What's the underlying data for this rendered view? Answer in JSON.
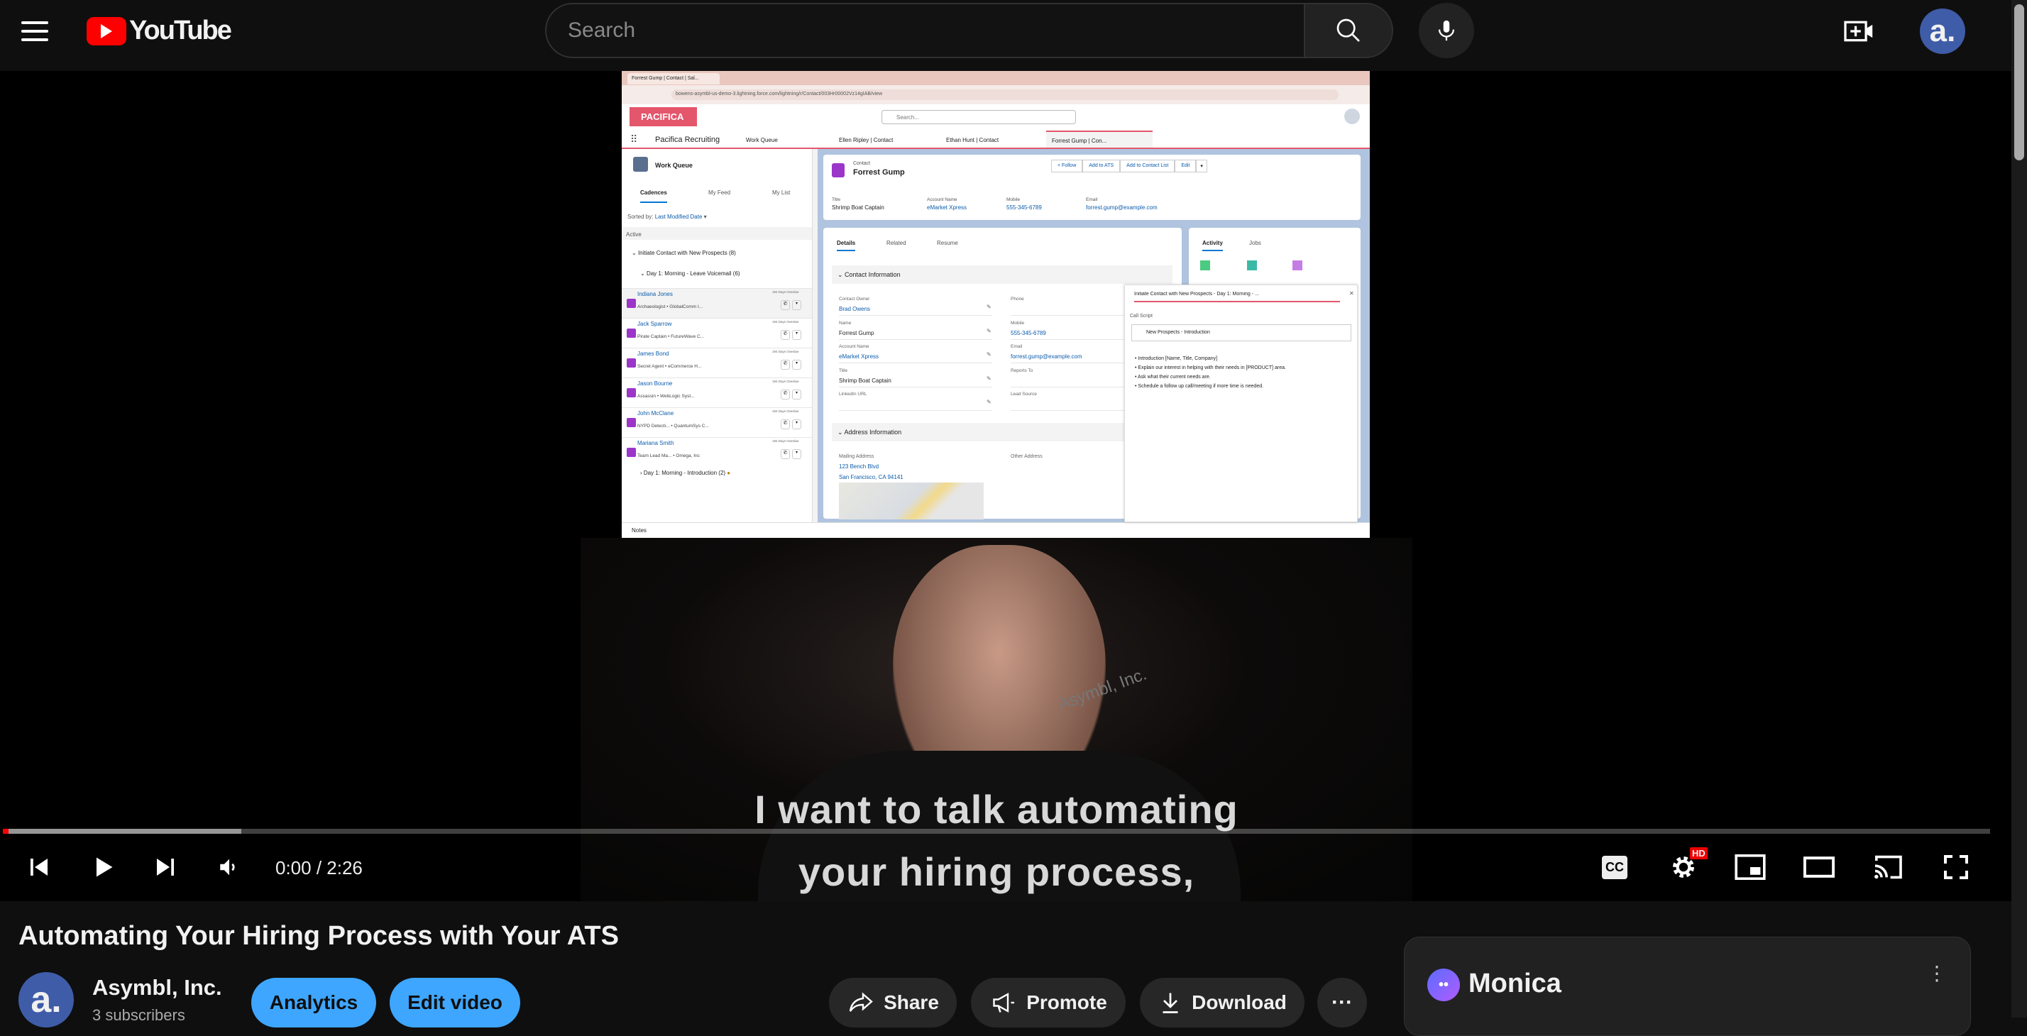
{
  "header": {
    "logo_text": "YouTube",
    "search_placeholder": "Search",
    "icons": [
      "menu-icon",
      "search-icon",
      "microphone-icon",
      "create-video-icon",
      "avatar"
    ],
    "brand_color": "#ff0000"
  },
  "video": {
    "embedded_screen": {
      "browser_tab": "Forrest Gump | Contact | Sal...",
      "url": "bowens-asymbl-us-demo-3.lightning.force.com/lightning/r/Contact/003Hr00002Vz14gIAB/view",
      "logo": "PACIFICA",
      "search_placeholder": "Search...",
      "app_name": "Pacifica Recruiting",
      "nav_tabs": [
        "Work Queue",
        "Ellen Ripley | Contact",
        "Ethan Hunt | Contact",
        "Forrest Gump | Con..."
      ],
      "work_queue": {
        "title": "Work Queue",
        "tabs": [
          "Cadences",
          "My Feed",
          "My List"
        ],
        "sorted_label": "Sorted by:",
        "sorted_value": "Last Modified Date",
        "active_label": "Active",
        "group": "Initiate Contact with New Prospects (8)",
        "step": "Day 1: Morning - Leave Voicemail (6)",
        "rows": [
          {
            "name": "Indiana Jones",
            "sub": "Archaeologist • GlobalComm I...",
            "due": "194 Days Overdue"
          },
          {
            "name": "Jack Sparrow",
            "sub": "Pirate Captain • FutureWave C...",
            "due": "194 Days Overdue"
          },
          {
            "name": "James Bond",
            "sub": "Secret Agent • eCommerce H...",
            "due": "194 Days Overdue"
          },
          {
            "name": "Jason Bourne",
            "sub": "Assassin • WebLogic Syst...",
            "due": "194 Days Overdue"
          },
          {
            "name": "John McClane",
            "sub": "NYPD Detecti... • QuantumSys C...",
            "due": "194 Days Overdue"
          },
          {
            "name": "Mariana Smith",
            "sub": "Team Lead Ma... • Omega, Inc",
            "due": "194 Days Overdue"
          }
        ],
        "next_step": "Day 1: Morning - Introduction (2)"
      },
      "contact": {
        "type": "Contact",
        "name": "Forrest Gump",
        "actions": [
          "+ Follow",
          "Add to ATS",
          "Add to Contact List",
          "Edit"
        ],
        "highlights": [
          {
            "label": "Title",
            "value": "Shrimp Boat Captain"
          },
          {
            "label": "Account Name",
            "value": "eMarket Xpress"
          },
          {
            "label": "Mobile",
            "value": "555-345-6789"
          },
          {
            "label": "Email",
            "value": "forrest.gump@example.com"
          }
        ],
        "tabs": [
          "Details",
          "Related",
          "Resume"
        ],
        "section1": "Contact Information",
        "fields_left": [
          {
            "label": "Contact Owner",
            "value": "Brad Owens"
          },
          {
            "label": "Name",
            "value": "Forrest Gump"
          },
          {
            "label": "Account Name",
            "value": "eMarket Xpress"
          },
          {
            "label": "Title",
            "value": "Shrimp Boat Captain"
          },
          {
            "label": "LinkedIn URL",
            "value": ""
          }
        ],
        "fields_right": [
          {
            "label": "Phone",
            "value": ""
          },
          {
            "label": "Mobile",
            "value": "555-345-6789"
          },
          {
            "label": "Email",
            "value": "forrest.gump@example.com"
          },
          {
            "label": "Reports To",
            "value": ""
          },
          {
            "label": "Lead Source",
            "value": ""
          }
        ],
        "section2": "Address Information",
        "mailing_label": "Mailing Address",
        "mailing_1": "123 Bench Blvd",
        "mailing_2": "San Francisco, CA 94141",
        "other_label": "Other Address"
      },
      "activity": {
        "tabs": [
          "Activity",
          "Jobs"
        ]
      },
      "call_panel": {
        "title": "Initiate Contact with New Prospects - Day 1: Morning - ...",
        "script_label": "Call Script",
        "script_name": "New Prospects - Introduction",
        "bullets": [
          "Introduction [Name, Title, Company]",
          "Explain our interest in helping with their needs in [PRODUCT] area.",
          "Ask what their current needs are.",
          "Schedule a follow up call/meeting if more time is needed."
        ]
      },
      "footer": "Notes"
    },
    "captions": [
      "I want to talk automating",
      "your hiring process,"
    ],
    "watermark": "Asymbl, Inc.",
    "time": "0:00 / 2:26",
    "progress_fraction": 0,
    "buffered_fraction": 0.12,
    "quality_badge": "HD"
  },
  "meta": {
    "title": "Automating Your Hiring Process with Your ATS",
    "channel": "Asymbl, Inc.",
    "subscribers": "3 subscribers",
    "buttons": {
      "analytics": "Analytics",
      "edit": "Edit video",
      "share": "Share",
      "promote": "Promote",
      "download": "Download"
    }
  },
  "monica": {
    "label": "Monica"
  }
}
